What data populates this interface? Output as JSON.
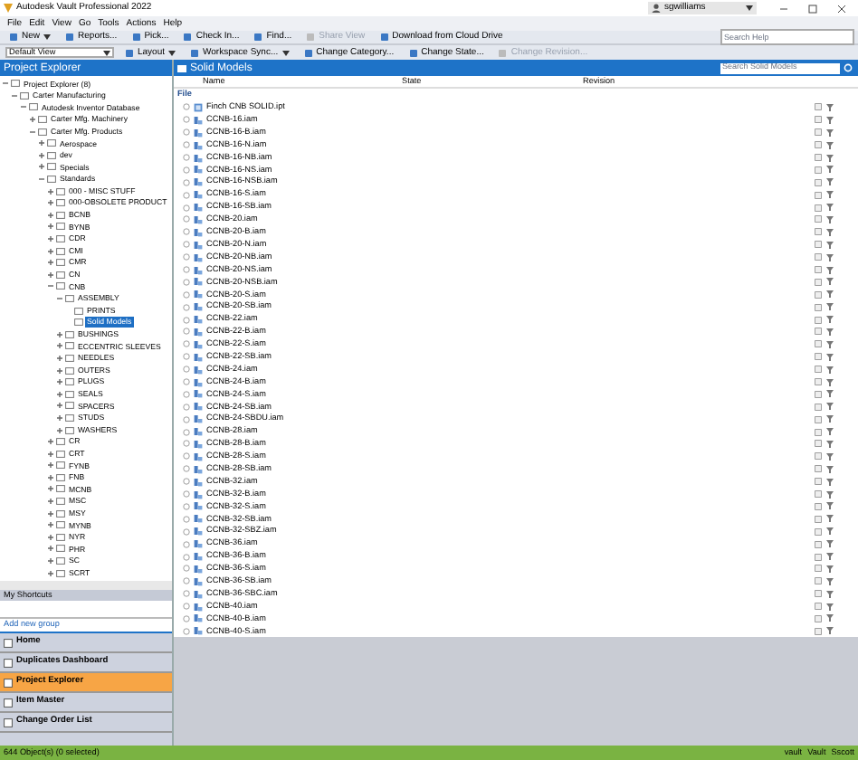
{
  "window": {
    "title": "Autodesk Vault Professional 2022",
    "user": "sgwilliams"
  },
  "menu": [
    "File",
    "Edit",
    "View",
    "Go",
    "Tools",
    "Actions",
    "Help"
  ],
  "toolbar_1": [
    {
      "label": "New",
      "dropdown": true,
      "disabled": false
    },
    {
      "label": "Reports...",
      "dropdown": false,
      "disabled": false
    },
    {
      "label": "Pick...",
      "dropdown": false,
      "disabled": false
    },
    {
      "label": "Check In...",
      "dropdown": false,
      "disabled": false
    },
    {
      "label": "Find...",
      "dropdown": false,
      "disabled": false
    },
    {
      "label": "Share View",
      "dropdown": false,
      "disabled": true
    },
    {
      "label": "Download from Cloud Drive",
      "dropdown": false,
      "disabled": false
    }
  ],
  "help_search": {
    "placeholder": "Search Help"
  },
  "view_select": {
    "value": "Default View"
  },
  "toolbar_2": [
    {
      "label": "Layout",
      "dropdown": true,
      "disabled": false
    },
    {
      "label": "Workspace Sync...",
      "dropdown": true,
      "disabled": false
    },
    {
      "label": "Change Category...",
      "dropdown": false,
      "disabled": false
    },
    {
      "label": "Change State...",
      "dropdown": false,
      "disabled": false
    },
    {
      "label": "Change Revision...",
      "dropdown": false,
      "disabled": true
    }
  ],
  "explorer": {
    "title": "Project Explorer",
    "tree": [
      {
        "label": "Project Explorer (8)",
        "expanded": true,
        "selected": false,
        "children": [
          {
            "label": "Carter Manufacturing",
            "expanded": true,
            "selected": false,
            "children": [
              {
                "label": "Autodesk Inventor Database",
                "expanded": true,
                "selected": false,
                "children": [
                  {
                    "label": "Carter Mfg. Machinery",
                    "expanded": false,
                    "selected": false
                  },
                  {
                    "label": "Carter Mfg. Products",
                    "expanded": true,
                    "selected": false,
                    "children": [
                      {
                        "label": "Aerospace",
                        "expanded": false,
                        "selected": false
                      },
                      {
                        "label": "dev",
                        "expanded": false,
                        "selected": false
                      },
                      {
                        "label": "Specials",
                        "expanded": false,
                        "selected": false
                      },
                      {
                        "label": "Standards",
                        "expanded": true,
                        "selected": false,
                        "children": [
                          {
                            "label": "000 - MISC STUFF",
                            "expanded": false,
                            "selected": false
                          },
                          {
                            "label": "000-OBSOLETE PRODUCT",
                            "expanded": false,
                            "selected": false
                          },
                          {
                            "label": "BCNB",
                            "expanded": false,
                            "selected": false
                          },
                          {
                            "label": "BYNB",
                            "expanded": false,
                            "selected": false
                          },
                          {
                            "label": "CDR",
                            "expanded": false,
                            "selected": false
                          },
                          {
                            "label": "CMI",
                            "expanded": false,
                            "selected": false
                          },
                          {
                            "label": "CMR",
                            "expanded": false,
                            "selected": false
                          },
                          {
                            "label": "CN",
                            "expanded": false,
                            "selected": false
                          },
                          {
                            "label": "CNB",
                            "expanded": true,
                            "selected": false,
                            "children": [
                              {
                                "label": "ASSEMBLY",
                                "expanded": true,
                                "selected": false,
                                "children": [
                                  {
                                    "label": "PRINTS",
                                    "selected": false
                                  },
                                  {
                                    "label": "Solid Models",
                                    "selected": true
                                  }
                                ]
                              },
                              {
                                "label": "BUSHINGS",
                                "expanded": false,
                                "selected": false
                              },
                              {
                                "label": "ECCENTRIC SLEEVES",
                                "expanded": false,
                                "selected": false
                              },
                              {
                                "label": "NEEDLES",
                                "expanded": false,
                                "selected": false
                              },
                              {
                                "label": "OUTERS",
                                "expanded": false,
                                "selected": false
                              },
                              {
                                "label": "PLUGS",
                                "expanded": false,
                                "selected": false
                              },
                              {
                                "label": "SEALS",
                                "expanded": false,
                                "selected": false
                              },
                              {
                                "label": "SPACERS",
                                "expanded": false,
                                "selected": false
                              },
                              {
                                "label": "STUDS",
                                "expanded": false,
                                "selected": false
                              },
                              {
                                "label": "WASHERS",
                                "expanded": false,
                                "selected": false
                              }
                            ]
                          },
                          {
                            "label": "CR",
                            "expanded": false,
                            "selected": false
                          },
                          {
                            "label": "CRT",
                            "expanded": false,
                            "selected": false
                          },
                          {
                            "label": "FYNB",
                            "expanded": false,
                            "selected": false
                          },
                          {
                            "label": "FNB",
                            "expanded": false,
                            "selected": false
                          },
                          {
                            "label": "MCNB",
                            "expanded": false,
                            "selected": false
                          },
                          {
                            "label": "MSC",
                            "expanded": false,
                            "selected": false
                          },
                          {
                            "label": "MSY",
                            "expanded": false,
                            "selected": false
                          },
                          {
                            "label": "MYNB",
                            "expanded": false,
                            "selected": false
                          },
                          {
                            "label": "NYR",
                            "expanded": false,
                            "selected": false
                          },
                          {
                            "label": "PHR",
                            "expanded": false,
                            "selected": false
                          },
                          {
                            "label": "SC",
                            "expanded": false,
                            "selected": false
                          },
                          {
                            "label": "SCRT",
                            "expanded": false,
                            "selected": false
                          }
                        ]
                      }
                    ]
                  }
                ]
              }
            ]
          }
        ]
      }
    ]
  },
  "shortcuts": {
    "title": "My Shortcuts",
    "add_link": "Add new group"
  },
  "nav": [
    {
      "label": "Home",
      "selected": false
    },
    {
      "label": "Duplicates Dashboard",
      "selected": false
    },
    {
      "label": "Project Explorer",
      "selected": true
    },
    {
      "label": "Item Master",
      "selected": false
    },
    {
      "label": "Change Order List",
      "selected": false
    }
  ],
  "content": {
    "title": "Solid Models",
    "search": {
      "placeholder": "Search Solid Models"
    },
    "columns": [
      "Name",
      "State",
      "Revision"
    ],
    "group": "File",
    "rows": [
      {
        "name": "Finch CNB SOLID.ipt",
        "kind": "part"
      },
      {
        "name": "CCNB-16.iam",
        "kind": "assembly"
      },
      {
        "name": "CCNB-16-B.iam",
        "kind": "assembly"
      },
      {
        "name": "CCNB-16-N.iam",
        "kind": "assembly"
      },
      {
        "name": "CCNB-16-NB.iam",
        "kind": "assembly"
      },
      {
        "name": "CCNB-16-NS.iam",
        "kind": "assembly"
      },
      {
        "name": "CCNB-16-NSB.iam",
        "kind": "assembly"
      },
      {
        "name": "CCNB-16-S.iam",
        "kind": "assembly"
      },
      {
        "name": "CCNB-16-SB.iam",
        "kind": "assembly"
      },
      {
        "name": "CCNB-20.iam",
        "kind": "assembly"
      },
      {
        "name": "CCNB-20-B.iam",
        "kind": "assembly"
      },
      {
        "name": "CCNB-20-N.iam",
        "kind": "assembly"
      },
      {
        "name": "CCNB-20-NB.iam",
        "kind": "assembly"
      },
      {
        "name": "CCNB-20-NS.iam",
        "kind": "assembly"
      },
      {
        "name": "CCNB-20-NSB.iam",
        "kind": "assembly"
      },
      {
        "name": "CCNB-20-S.iam",
        "kind": "assembly"
      },
      {
        "name": "CCNB-20-SB.iam",
        "kind": "assembly"
      },
      {
        "name": "CCNB-22.iam",
        "kind": "assembly"
      },
      {
        "name": "CCNB-22-B.iam",
        "kind": "assembly"
      },
      {
        "name": "CCNB-22-S.iam",
        "kind": "assembly"
      },
      {
        "name": "CCNB-22-SB.iam",
        "kind": "assembly"
      },
      {
        "name": "CCNB-24.iam",
        "kind": "assembly"
      },
      {
        "name": "CCNB-24-B.iam",
        "kind": "assembly"
      },
      {
        "name": "CCNB-24-S.iam",
        "kind": "assembly"
      },
      {
        "name": "CCNB-24-SB.iam",
        "kind": "assembly"
      },
      {
        "name": "CCNB-24-SBDU.iam",
        "kind": "assembly"
      },
      {
        "name": "CCNB-28.iam",
        "kind": "assembly"
      },
      {
        "name": "CCNB-28-B.iam",
        "kind": "assembly"
      },
      {
        "name": "CCNB-28-S.iam",
        "kind": "assembly"
      },
      {
        "name": "CCNB-28-SB.iam",
        "kind": "assembly"
      },
      {
        "name": "CCNB-32.iam",
        "kind": "assembly"
      },
      {
        "name": "CCNB-32-B.iam",
        "kind": "assembly"
      },
      {
        "name": "CCNB-32-S.iam",
        "kind": "assembly"
      },
      {
        "name": "CCNB-32-SB.iam",
        "kind": "assembly"
      },
      {
        "name": "CCNB-32-SBZ.iam",
        "kind": "assembly"
      },
      {
        "name": "CCNB-36.iam",
        "kind": "assembly"
      },
      {
        "name": "CCNB-36-B.iam",
        "kind": "assembly"
      },
      {
        "name": "CCNB-36-S.iam",
        "kind": "assembly"
      },
      {
        "name": "CCNB-36-SB.iam",
        "kind": "assembly"
      },
      {
        "name": "CCNB-36-SBC.iam",
        "kind": "assembly"
      },
      {
        "name": "CCNB-40.iam",
        "kind": "assembly"
      },
      {
        "name": "CCNB-40-B.iam",
        "kind": "assembly"
      },
      {
        "name": "CCNB-40-S.iam",
        "kind": "assembly"
      }
    ]
  },
  "status_bar": {
    "text": "644 Object(s) (0 selected)",
    "items": [
      "vault",
      "Vault",
      "Sscott"
    ]
  }
}
